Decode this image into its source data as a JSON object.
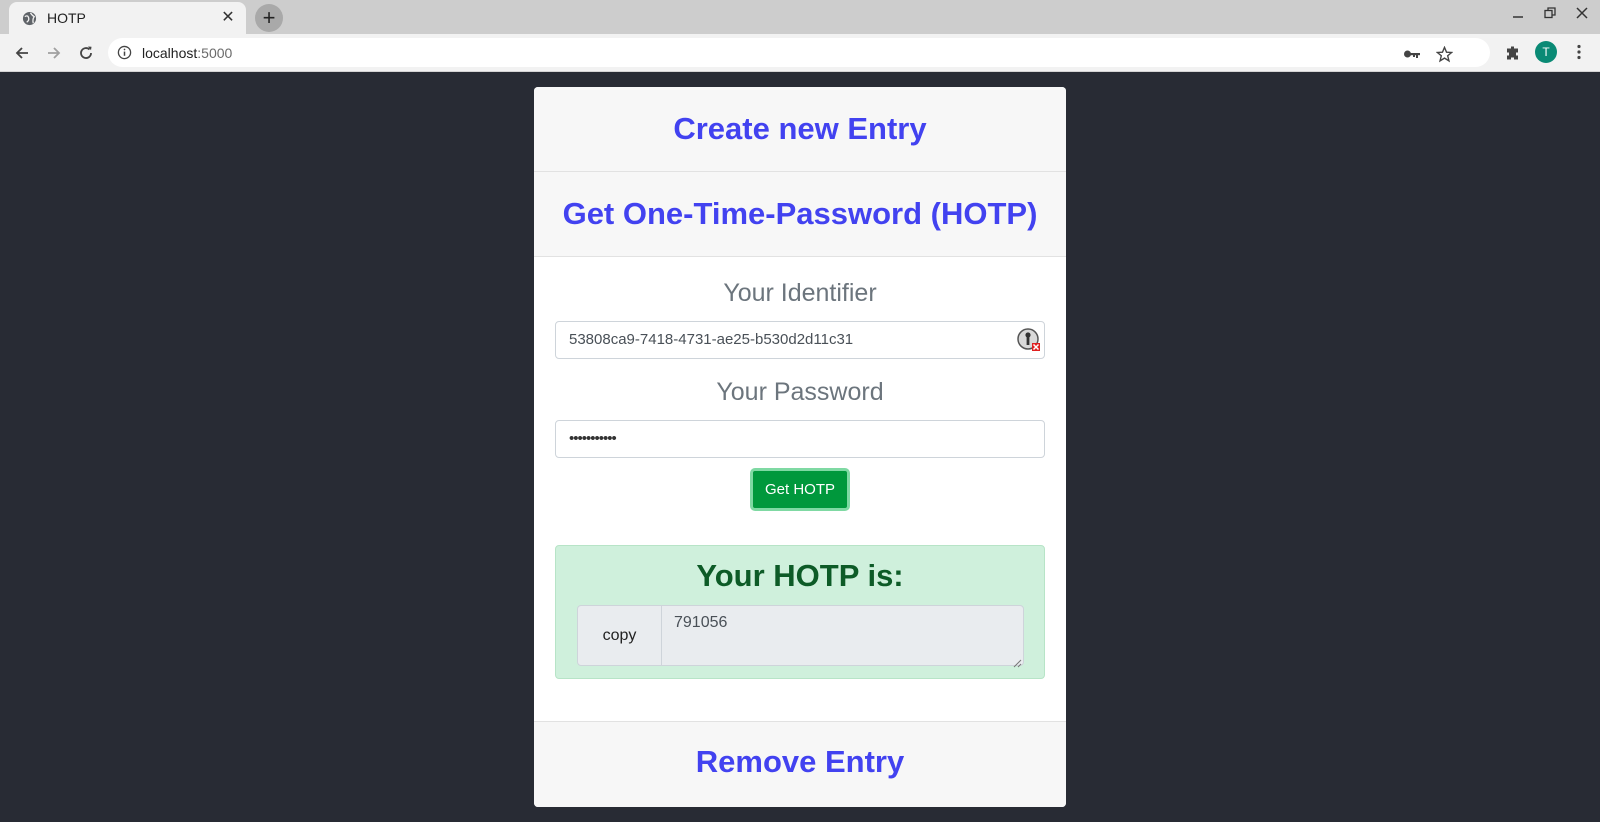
{
  "browser": {
    "tab_title": "HOTP",
    "url_host": "localhost",
    "url_port": ":5000",
    "profile_initial": "T"
  },
  "page": {
    "create_entry": "Create new Entry",
    "get_otp": "Get One-Time-Password (HOTP)",
    "identifier_label": "Your Identifier",
    "identifier_value": "53808ca9-7418-4731-ae25-b530d2d11c31",
    "password_label": "Your Password",
    "password_mask": "•••••••••••",
    "get_hotp_button": "Get HOTP",
    "result_title": "Your HOTP is:",
    "copy_button": "copy",
    "hotp_value": "791056",
    "remove_entry": "Remove Entry"
  },
  "colors": {
    "page_background": "#282b34",
    "link": "#4242f0",
    "button": "#00983c",
    "alert_background": "#cff0dc",
    "alert_text": "#0d5b27"
  }
}
